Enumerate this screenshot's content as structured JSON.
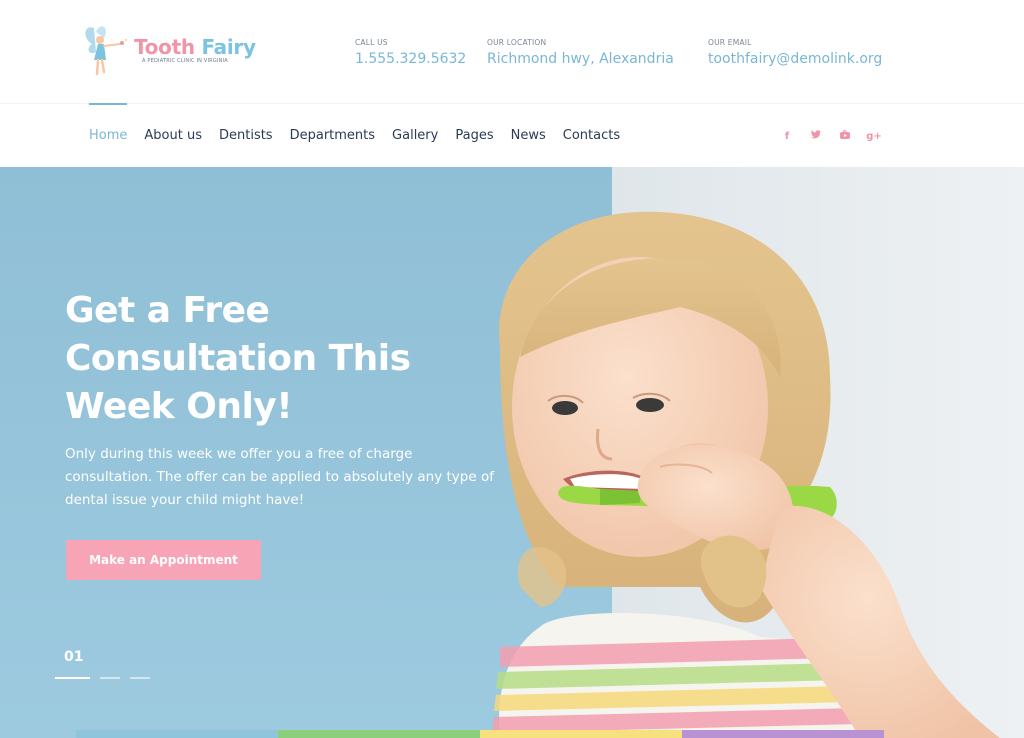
{
  "logo": {
    "title_part1": "Tooth",
    "title_part2": "Fairy",
    "subtitle": "A pediatric clinic in Virginia"
  },
  "contacts": {
    "phone": {
      "label": "CALL US",
      "value": "1.555.329.5632"
    },
    "location": {
      "label": "OUR LOCATION",
      "value": "Richmond hwy, Alexandria"
    },
    "email": {
      "label": "OUR EMAIL",
      "value": "toothfairy@demolink.org"
    }
  },
  "nav": {
    "items": [
      {
        "label": "Home",
        "active": true
      },
      {
        "label": "About us"
      },
      {
        "label": "Dentists"
      },
      {
        "label": "Departments"
      },
      {
        "label": "Gallery"
      },
      {
        "label": "Pages"
      },
      {
        "label": "News"
      },
      {
        "label": "Contacts"
      }
    ]
  },
  "social": {
    "facebook": "f",
    "twitter": "t",
    "youtube": "▶",
    "googleplus": "g+"
  },
  "hero": {
    "title_line1": "Get a Free",
    "title_line2": "Consultation This",
    "title_line3": "Week Only!",
    "text": "Only during this week we offer you a free of charge consultation. The offer can be applied to absolutely any type of dental issue your child might have!",
    "button": "Make an Appointment",
    "slide_number": "01"
  },
  "colors": {
    "accent_blue": "#79b7d6",
    "accent_pink": "#f294a8",
    "hero_bg": "#9fc9dc",
    "strip": [
      "#8ec5dc",
      "#8bcf7d",
      "#f7e17c",
      "#b892d2"
    ]
  }
}
